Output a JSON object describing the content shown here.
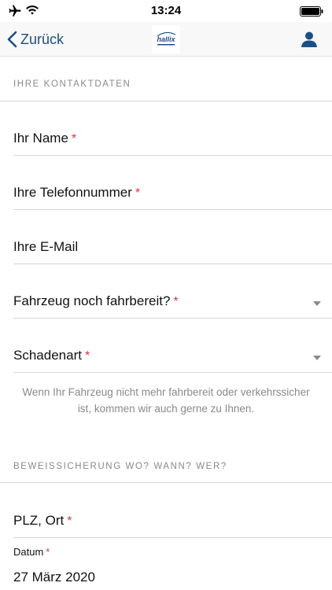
{
  "status_bar": {
    "time": "13:24"
  },
  "nav": {
    "back_label": "Zurück",
    "logo_text": "hallix"
  },
  "sections": {
    "contact_header": "IHRE KONTAKTDATEN",
    "evidence_header": "BEWEISSICHERUNG WO? WANN? WER?"
  },
  "fields": {
    "name": {
      "label": "Ihr Name",
      "required_mark": "*"
    },
    "phone": {
      "label": "Ihre Telefonnummer",
      "required_mark": "*"
    },
    "email": {
      "label": "Ihre E-Mail"
    },
    "drivable": {
      "label": "Fahrzeug noch fahrbereit?",
      "required_mark": "*"
    },
    "damage_type": {
      "label": "Schadenart",
      "required_mark": "*"
    },
    "location": {
      "label": "PLZ, Ort",
      "required_mark": "*"
    },
    "date": {
      "label": "Datum",
      "required_mark": "*",
      "value": "27 März 2020"
    }
  },
  "hint_text": "Wenn Ihr Fahrzeug nicht mehr fahrbereit oder verkehrssicher ist, kommen wir auch gerne zu Ihnen.",
  "colors": {
    "accent": "#1a4f86",
    "required": "#d9363e",
    "muted": "#8a8a8a"
  }
}
